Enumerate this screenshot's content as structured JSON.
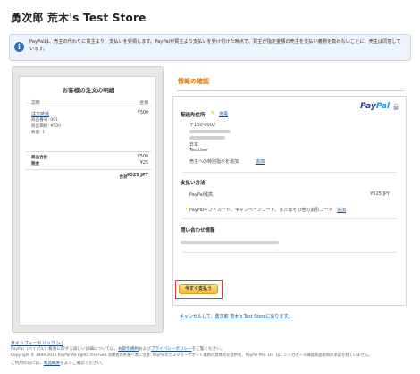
{
  "header": {
    "store_title": "勇次郎 荒木's Test Store"
  },
  "notice": {
    "icon": "info-icon",
    "text": "PayPalは、売主の代わりに買主より、支払いを受領します。PayPalが買主より支払いを受け付けた時点で、買主が指定金額の売主を支払い義務を負わないことに、売主は同意しています。"
  },
  "order": {
    "title": "お客様の注文の明細",
    "col_desc": "説明",
    "col_amount": "金額",
    "item_name": "注文技話",
    "item_amount": "¥500",
    "item_no": "商品番号: 001",
    "item_price": "商品価格: ¥500",
    "item_qty": "数量: 1",
    "subtotal_label": "商品合計",
    "subtotal_value": "¥500",
    "tax_label": "税金",
    "tax_value": "¥25",
    "total_label": "合計",
    "total_value": "¥525 JPY"
  },
  "confirm": {
    "title": "情報の確認",
    "paypal_logo_a": "Pay",
    "paypal_logo_b": "Pal",
    "shipping_heading": "配送先住所",
    "edit_label": "変更",
    "postal": "〒150-0002",
    "country": "日本",
    "user": "TestUser",
    "instructions_label": "売主への特別指示を追加:",
    "instructions_link": "追加",
    "payment_heading": "支払い方法",
    "payment_method": "PayPal残高",
    "payment_amount": "¥525 JPY",
    "promo_text": "PayPalギフトカード、キャンペーンコード、またはその他の割引コード",
    "promo_link": "追加",
    "contact_heading": "問い合わせ情報",
    "pay_button": "今すぐ支払う",
    "cancel_link": "キャンセルして、勇次郎 荒木's Test Storeに戻ります。"
  },
  "footer": {
    "feedback_link": "サイトフィードバック",
    "line1_prefix": "PayPal（ペイパル）概要に関する詳しい詳細については、",
    "line1_link1": "お取引規約",
    "line1_mid": "および",
    "line1_link2": "プライバシーポリシー",
    "line1_suffix": "をご覧ください。",
    "line2": "Copyright © 1999-2011 PayPal All rights reserved.消費者の各種へ本に注意: PayPalのカスタマーサポート業務の具体的な提供者、PayPal Pte. Ltd. は、シンガポール通貨商品規制の承認を経ていません。",
    "line3_prefix": "ご利用の前には、",
    "line3_link": "製品概要",
    "line3_suffix": "をよくご確認ください。"
  },
  "colors": {
    "accent_orange": "#e07b00",
    "link_blue": "#1a4f8b",
    "paypal_dark": "#253b80",
    "paypal_light": "#179bd7",
    "highlight_red": "#d93a3a"
  }
}
